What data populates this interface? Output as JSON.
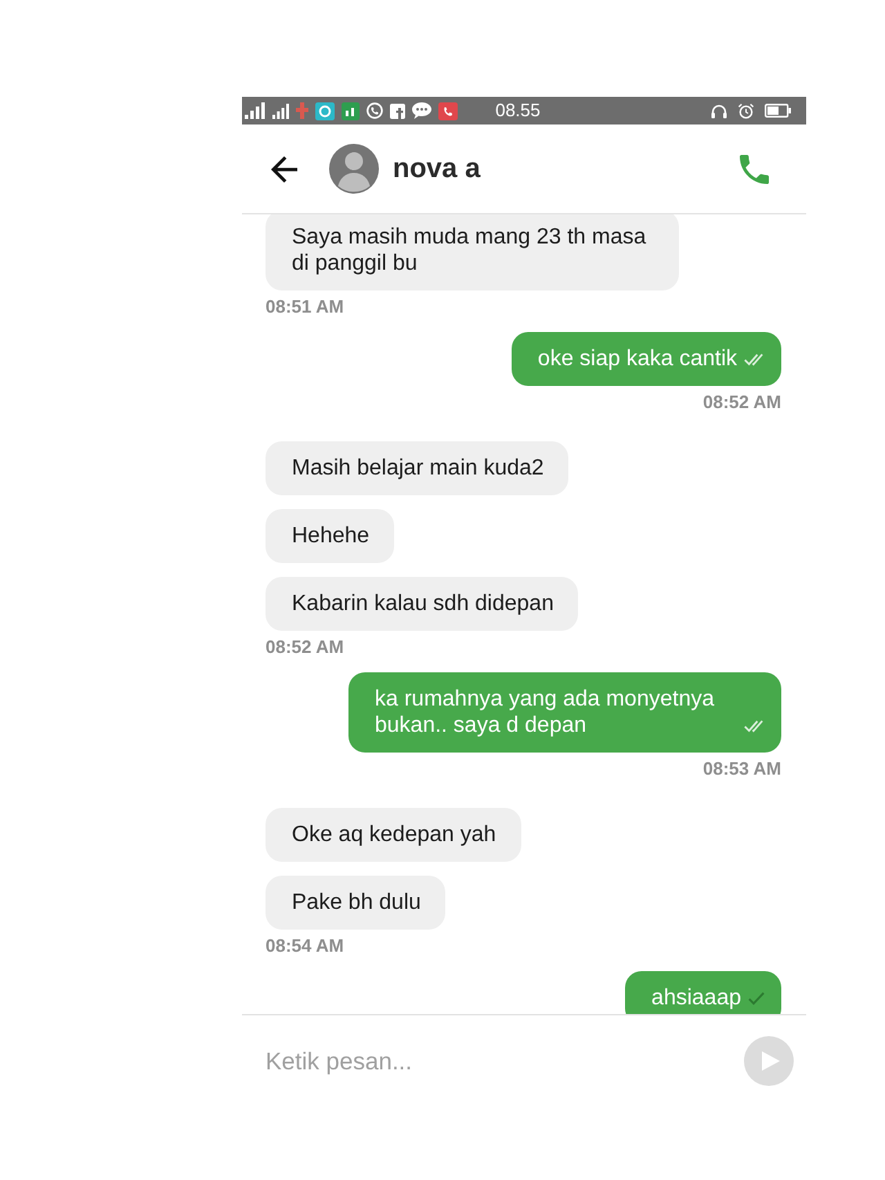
{
  "status_bar": {
    "time": "08.55"
  },
  "header": {
    "contact_name": "nova a"
  },
  "chat": {
    "groups": [
      {
        "kind": "incoming",
        "messages": [
          {
            "text": "Saya masih muda mang 23 th masa di panggil bu"
          }
        ],
        "time": "08:51 AM"
      },
      {
        "kind": "outgoing",
        "messages": [
          {
            "text": "oke siap kaka cantik",
            "delivered": true
          }
        ],
        "time": "08:52 AM"
      },
      {
        "kind": "incoming",
        "messages": [
          {
            "text": "Masih belajar main kuda2"
          },
          {
            "text": "Hehehe"
          },
          {
            "text": "Kabarin kalau sdh didepan"
          }
        ],
        "time": "08:52 AM"
      },
      {
        "kind": "outgoing",
        "messages": [
          {
            "text": "ka rumahnya yang ada monyetnya bukan.. saya d depan",
            "delivered": true
          }
        ],
        "time": "08:53 AM"
      },
      {
        "kind": "incoming",
        "messages": [
          {
            "text": "Oke aq kedepan yah"
          },
          {
            "text": "Pake bh dulu"
          }
        ],
        "time": "08:54 AM"
      },
      {
        "kind": "outgoing",
        "messages": [
          {
            "text": "ahsiaaap",
            "delivered": false
          }
        ]
      }
    ]
  },
  "composer": {
    "placeholder": "Ketik pesan..."
  }
}
